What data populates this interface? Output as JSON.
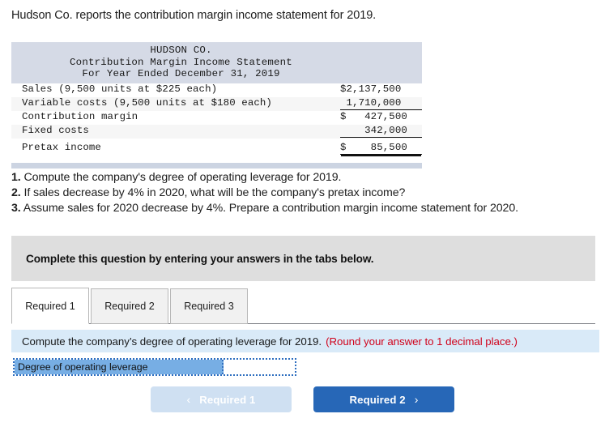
{
  "intro": "Hudson Co. reports the contribution margin income statement for 2019.",
  "statement": {
    "title_lines": [
      "HUDSON CO.",
      "Contribution Margin Income Statement",
      "For Year Ended December 31, 2019"
    ],
    "rows": [
      {
        "label": "Sales (9,500 units at $225 each)",
        "amount": "$2,137,500",
        "rule": "none"
      },
      {
        "label": "Variable costs (9,500 units at $180 each)",
        "amount": " 1,710,000",
        "rule": "single"
      },
      {
        "label": "Contribution margin",
        "amount": "$   427,500",
        "rule": "none"
      },
      {
        "label": "Fixed costs",
        "amount": "    342,000",
        "rule": "single"
      },
      {
        "label": "Pretax income",
        "amount": "$    85,500",
        "rule": "double"
      }
    ]
  },
  "questions": [
    {
      "number": "1.",
      "text": "Compute the company's degree of operating leverage for 2019."
    },
    {
      "number": "2.",
      "text": "If sales decrease by 4% in 2020, what will be the company's pretax income?"
    },
    {
      "number": "3.",
      "text": "Assume sales for 2020 decrease by 4%. Prepare a contribution margin income statement for 2020."
    }
  ],
  "banner": {
    "text": "Complete this question by entering your answers in the tabs below."
  },
  "tabs": [
    {
      "label": "Required 1",
      "active": true
    },
    {
      "label": "Required 2",
      "active": false
    },
    {
      "label": "Required 3",
      "active": false
    }
  ],
  "requirement": {
    "prompt": "Compute the company’s degree of operating leverage for 2019.",
    "hint": "(Round your answer to 1 decimal place.)"
  },
  "answer": {
    "label": "Degree of operating leverage",
    "value": "",
    "placeholder": ""
  },
  "nav": {
    "prev_label": "Required 1",
    "prev_icon": "chevron-left-icon",
    "prev_glyph": "‹",
    "next_label": "Required 2",
    "next_icon": "chevron-right-icon",
    "next_glyph": "›"
  },
  "colors": {
    "statement_header_bg": "#d5dae6",
    "statement_footer_bg": "#ccd4e2",
    "banner_bg": "#dedede",
    "requirement_bg": "#d9eaf8",
    "hint_red": "#d0021b",
    "answer_label_bg": "#77aee4",
    "answer_border": "#2f6fc0",
    "next_button_bg": "#2767b7",
    "prev_button_bg": "#cfe0f2"
  }
}
